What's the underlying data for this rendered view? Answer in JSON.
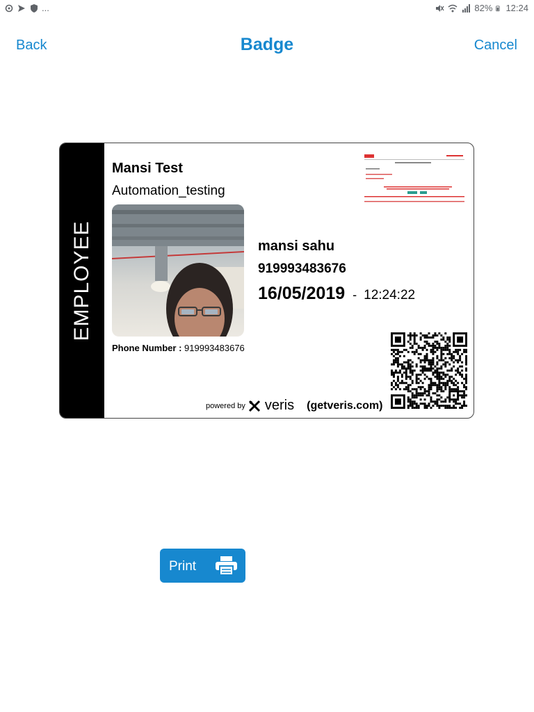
{
  "status_bar": {
    "left_icons": [
      "sync-icon",
      "send-icon",
      "shield-icon",
      "more-icon"
    ],
    "more_text": "...",
    "battery_text": "82%",
    "time": "12:24"
  },
  "header": {
    "back_label": "Back",
    "title": "Badge",
    "cancel_label": "Cancel"
  },
  "badge": {
    "badge_type": "EMPLOYEE",
    "host_name": "Mansi Test",
    "department": "Automation_testing",
    "phone_label": "Phone Number :",
    "phone_value": "919993483676",
    "visitor_name": "mansi sahu",
    "visitor_phone": "919993483676",
    "date": "16/05/2019",
    "separator": "-",
    "time": "12:24:22",
    "powered_by": "powered by",
    "brand": "veris",
    "website": "(getveris.com)"
  },
  "print_button": {
    "label": "Print",
    "icon": "printer-icon"
  },
  "colors": {
    "accent": "#1788cf",
    "stripe": "#000000"
  }
}
